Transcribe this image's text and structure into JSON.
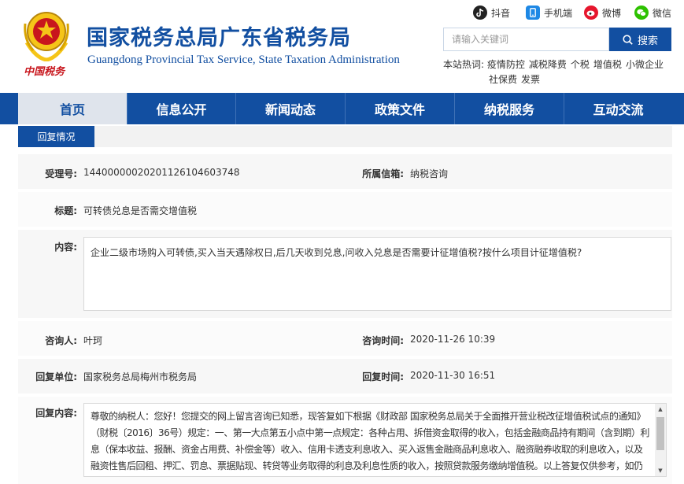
{
  "header": {
    "title_cn": "国家税务总局广东省税务局",
    "title_en": "Guangdong Provincial Tax Service, State Taxation Administration",
    "slogan": "中国税务"
  },
  "social": [
    {
      "label": "抖音",
      "icon": "douyin-icon",
      "color": "#222222"
    },
    {
      "label": "手机端",
      "icon": "mobile-icon",
      "color": "#1e88e5"
    },
    {
      "label": "微博",
      "icon": "weibo-icon",
      "color": "#e6162d"
    },
    {
      "label": "微信",
      "icon": "wechat-icon",
      "color": "#2dc100"
    }
  ],
  "search": {
    "placeholder": "请输入关键词",
    "button": "搜索"
  },
  "hot": {
    "label": "本站热词:",
    "terms": [
      "疫情防控",
      "减税降费",
      "个税",
      "增值税",
      "小微企业",
      "社保费",
      "发票"
    ]
  },
  "nav": {
    "items": [
      "首页",
      "信息公开",
      "新闻动态",
      "政策文件",
      "纳税服务",
      "互动交流"
    ],
    "active": "首页"
  },
  "subtab": "回复情况",
  "form": {
    "accept_no": {
      "label": "受理号:",
      "value": "144000000202011261046037​48"
    },
    "mailbox": {
      "label": "所属信箱:",
      "value": "纳税咨询"
    },
    "title": {
      "label": "标题:",
      "value": "可转债兑息是否需交增值税"
    },
    "content": {
      "label": "内容:",
      "value": "企业二级市场购入可转债,买入当天遇除权日,后几天收到兑息,问收入兑息是否需要计征增值税?按什么项目计征增值税?"
    },
    "asker": {
      "label": "咨询人:",
      "value": "叶珂"
    },
    "ask_time": {
      "label": "咨询时间:",
      "value": "2020-11-26 10:39"
    },
    "reply_unit": {
      "label": "回复单位:",
      "value": "国家税务总局梅州市税务局"
    },
    "reply_time": {
      "label": "回复时间:",
      "value": "2020-11-30 16:51"
    },
    "reply_content": {
      "label": "回复内容:",
      "lines": [
        "尊敬的纳税人：您好！您提交的网上留言咨询已知悉，现答复如下根据《财政部 国家税务总局关于全面推开营业税改征增值税试点的通知》",
        "（财税〔2016〕36号）规定：一、第一大点第五小点中第一点规定：各种占用、拆借资金取得的收入，包括金融商品持有期间（含到期）利",
        "息（保本收益、报酬、资金占用费、补偿金等）收入、信用卡透支利息收入、买入返售金融商品利息收入、融资融券收取的利息收入，以及",
        "融资性售后回租、押汇、罚息、票据贴现、转贷等业务取得的利息及利息性质的收入，按照贷款服务缴纳增值税。以上答复仅供参考，如仍"
      ]
    }
  }
}
